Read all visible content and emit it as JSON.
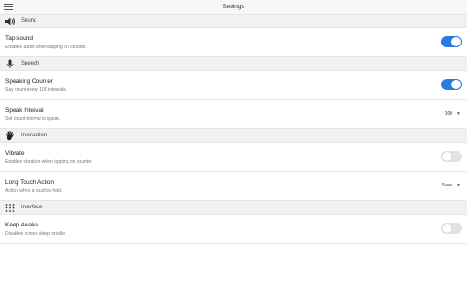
{
  "header": {
    "title": "Settings"
  },
  "sections": {
    "sound": {
      "title": "Sound",
      "icon": "speaker-icon",
      "tap_sound": {
        "label": "Tap sound",
        "description": "Enables audio when tapping on counter.",
        "enabled": true
      }
    },
    "speech": {
      "title": "Speech",
      "icon": "microphone-icon",
      "speaking_counter": {
        "label": "Speaking Counter",
        "description": "Say count every 100 intervals.",
        "enabled": true
      },
      "speak_interval": {
        "label": "Speak Interval",
        "description": "Set count interval to speak.",
        "value": "100"
      }
    },
    "interaction": {
      "title": "Interaction",
      "icon": "hand-icon",
      "vibrate": {
        "label": "Vibrate",
        "description": "Enables vibration when tapping on counter.",
        "enabled": false
      },
      "long_touch": {
        "label": "Long Touch Action",
        "description": "Action when a touch is held.",
        "value": "Save"
      }
    },
    "interface": {
      "title": "Interface",
      "icon": "grid-dots-icon",
      "keep_awake": {
        "label": "Keep Awake",
        "description": "Disables screen sleep on idle.",
        "enabled": false
      }
    }
  },
  "colors": {
    "accent": "#2a7ae2",
    "toggle_off": "#e2e2e2",
    "header_bg": "#f1f1f1"
  }
}
